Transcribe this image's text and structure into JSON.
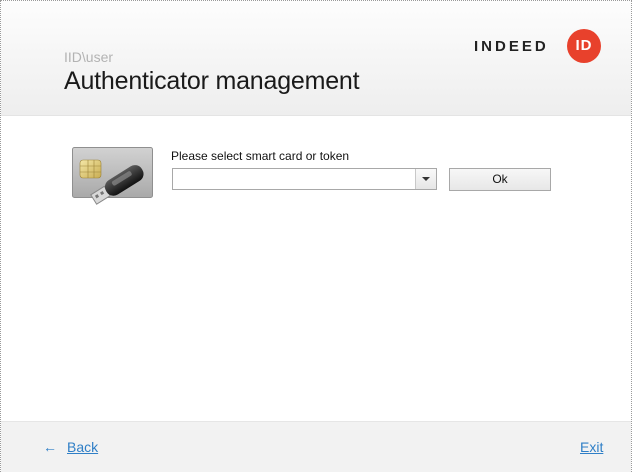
{
  "header": {
    "user": "IID\\user",
    "title": "Authenticator management",
    "logo_word": "INDEED",
    "logo_badge": "ID"
  },
  "main": {
    "device_icon": "smartcard-usb-token-icon",
    "prompt": "Please select smart card or token",
    "select_value": "",
    "ok_label": "Ok"
  },
  "footer": {
    "back_arrow": "←",
    "back_label": "Back",
    "exit_label": "Exit"
  },
  "colors": {
    "brand_red": "#e8412c",
    "link_blue": "#2f7fc7"
  }
}
